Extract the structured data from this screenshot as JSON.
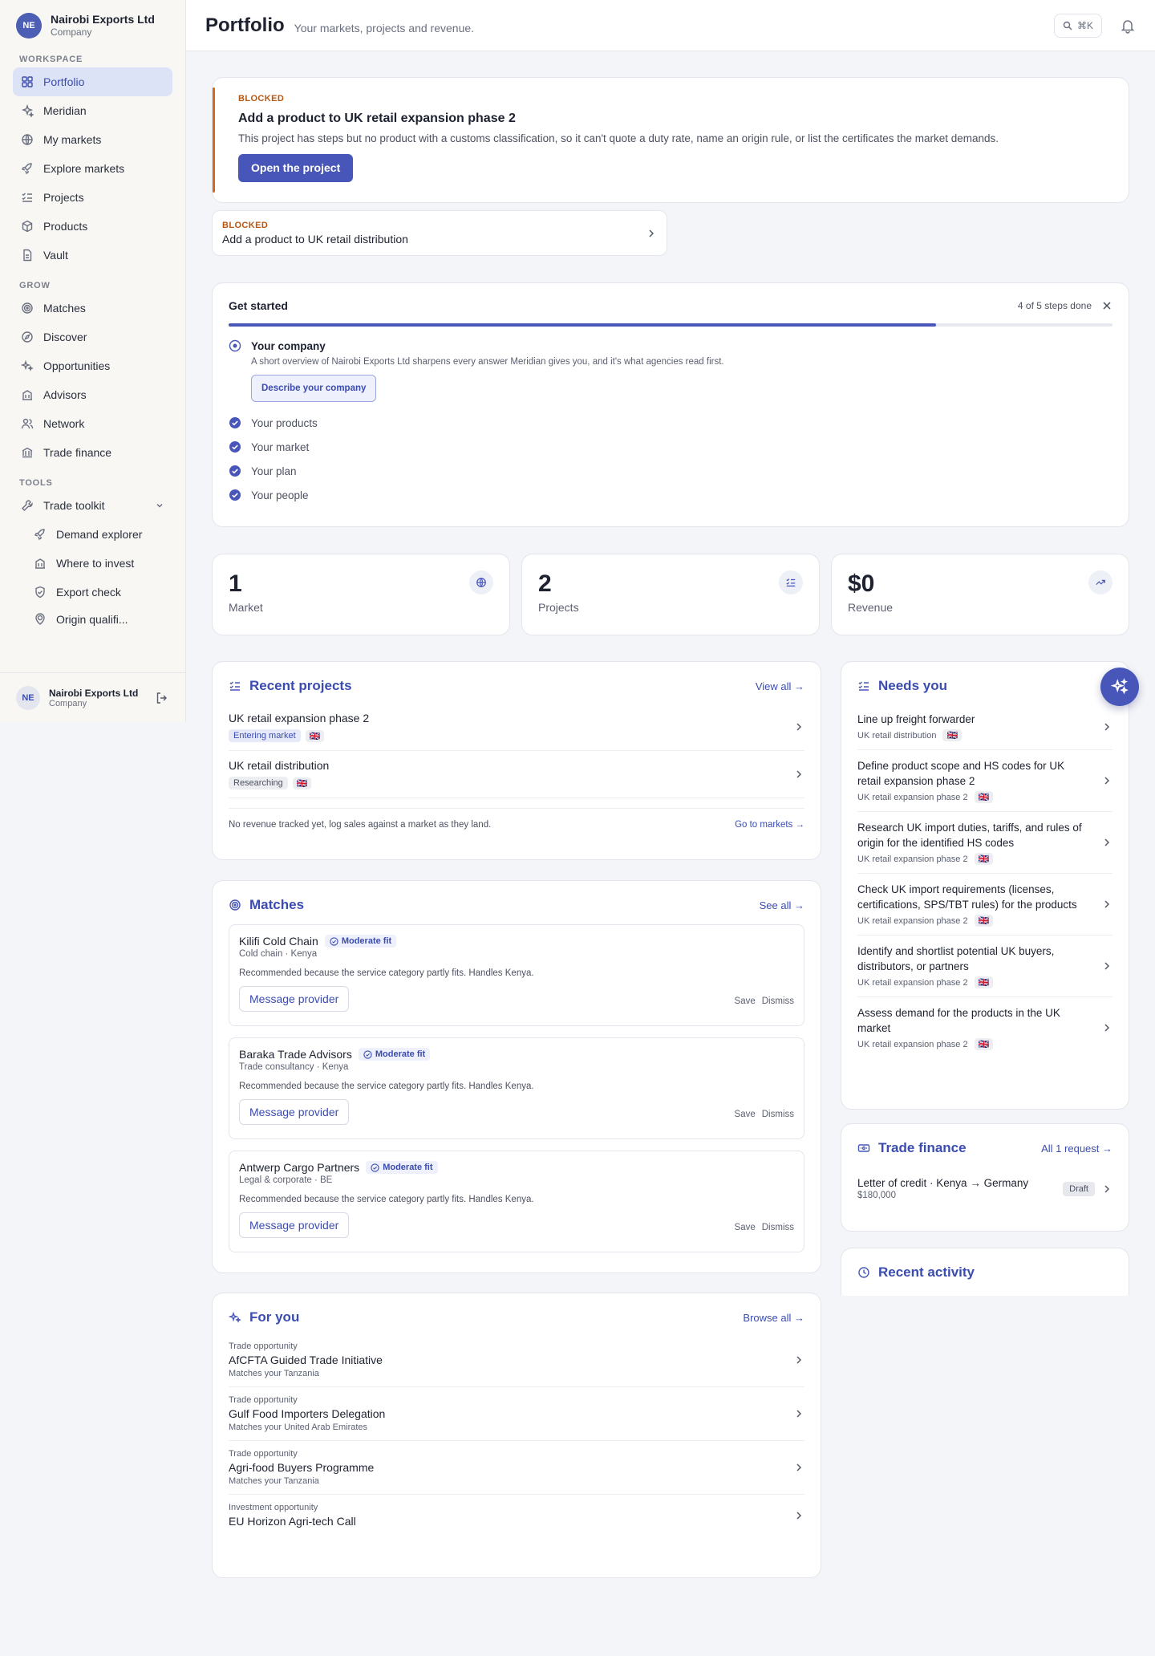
{
  "org": {
    "initials": "NE",
    "name": "Nairobi Exports Ltd",
    "type": "Company"
  },
  "sidebar": {
    "sections": {
      "workspace": "WORKSPACE",
      "grow": "GROW",
      "tools": "TOOLS"
    },
    "workspace": [
      "Portfolio",
      "Meridian",
      "My markets",
      "Explore markets",
      "Projects",
      "Products",
      "Vault"
    ],
    "grow": [
      "Matches",
      "Discover",
      "Opportunities",
      "Advisors",
      "Network",
      "Trade finance"
    ],
    "toolkit": "Trade toolkit",
    "tools": [
      "Demand explorer",
      "Where to invest",
      "Export check",
      "Origin qualifi..."
    ],
    "active": "Portfolio"
  },
  "header": {
    "title": "Portfolio",
    "subtitle": "Your markets, projects and revenue.",
    "shortcut": "⌘K"
  },
  "blocked": {
    "tag": "BLOCKED",
    "title": "Add a product to UK retail expansion phase 2",
    "description": "This project has steps but no product with a customs classification, so it can't quote a duty rate, name an origin rule, or list the certificates the market demands.",
    "button": "Open the project",
    "second_tag": "BLOCKED",
    "second_title": "Add a product to UK retail distribution"
  },
  "get_started": {
    "title": "Get started",
    "progress_label": "4 of 5 steps done",
    "progress": 0.8,
    "active_step": "Your company",
    "active_desc": "A short overview of Nairobi Exports Ltd sharpens every answer Meridian gives you, and it's what agencies read first.",
    "active_button": "Describe your company",
    "done_steps": [
      "Your products",
      "Your market",
      "Your plan",
      "Your people"
    ]
  },
  "stats": [
    {
      "value": "1",
      "label": "Market",
      "icon": "globe-icon"
    },
    {
      "value": "2",
      "label": "Projects",
      "icon": "checklist-icon"
    },
    {
      "value": "$0",
      "label": "Revenue",
      "icon": "trend-icon"
    }
  ],
  "recent_projects": {
    "title": "Recent projects",
    "link": "View all →",
    "items": [
      {
        "name": "UK retail expansion phase 2",
        "status": "Entering market",
        "flag": "🇬🇧"
      },
      {
        "name": "UK retail distribution",
        "status": "Researching",
        "flag": "🇬🇧"
      }
    ],
    "footer": "No revenue tracked yet, log sales against a market as they land.",
    "footer_link": "Go to markets →"
  },
  "matches": {
    "title": "Matches",
    "link": "See all →",
    "items": [
      {
        "name": "Kilifi Cold Chain",
        "fit": "Moderate fit",
        "sub": "Cold chain · Kenya",
        "desc": "Recommended because the service category partly fits. Handles Kenya."
      },
      {
        "name": "Baraka Trade Advisors",
        "fit": "Moderate fit",
        "sub": "Trade consultancy · Kenya",
        "desc": "Recommended because the service category partly fits. Handles Kenya."
      },
      {
        "name": "Antwerp Cargo Partners",
        "fit": "Moderate fit",
        "sub": "Legal & corporate · BE",
        "desc": "Recommended because the service category partly fits. Handles Kenya."
      }
    ],
    "message_label": "Message provider",
    "save_label": "Save",
    "dismiss_label": "Dismiss"
  },
  "for_you": {
    "title": "For you",
    "link": "Browse all →",
    "items": [
      {
        "type": "Trade opportunity",
        "name": "AfCFTA Guided Trade Initiative",
        "sub": "Matches your Tanzania"
      },
      {
        "type": "Trade opportunity",
        "name": "Gulf Food Importers Delegation",
        "sub": "Matches your United Arab Emirates"
      },
      {
        "type": "Trade opportunity",
        "name": "Agri-food Buyers Programme",
        "sub": "Matches your Tanzania"
      },
      {
        "type": "Investment opportunity",
        "name": "EU Horizon Agri-tech Call",
        "sub": ""
      }
    ]
  },
  "needs_you": {
    "title": "Needs you",
    "items": [
      {
        "name": "Line up freight forwarder",
        "project": "UK retail distribution",
        "flag": "🇬🇧"
      },
      {
        "name": "Define product scope and HS codes for UK retail expansion phase 2",
        "project": "UK retail expansion phase 2",
        "flag": "🇬🇧"
      },
      {
        "name": "Research UK import duties, tariffs, and rules of origin for the identified HS codes",
        "project": "UK retail expansion phase 2",
        "flag": "🇬🇧"
      },
      {
        "name": "Check UK import requirements (licenses, certifications, SPS/TBT rules) for the products",
        "project": "UK retail expansion phase 2",
        "flag": "🇬🇧"
      },
      {
        "name": "Identify and shortlist potential UK buyers, distributors, or partners",
        "project": "UK retail expansion phase 2",
        "flag": "🇬🇧"
      },
      {
        "name": "Assess demand for the products in the UK market",
        "project": "UK retail expansion phase 2",
        "flag": "🇬🇧"
      }
    ]
  },
  "trade_finance": {
    "title": "Trade finance",
    "link": "All 1 request →",
    "item": {
      "name": "Letter of credit · Kenya → Germany",
      "amount": "$180,000",
      "status": "Draft"
    }
  },
  "recent_activity": {
    "title": "Recent activity"
  },
  "colors": {
    "accent": "#4756b8",
    "blocked": "#d46b1b"
  }
}
